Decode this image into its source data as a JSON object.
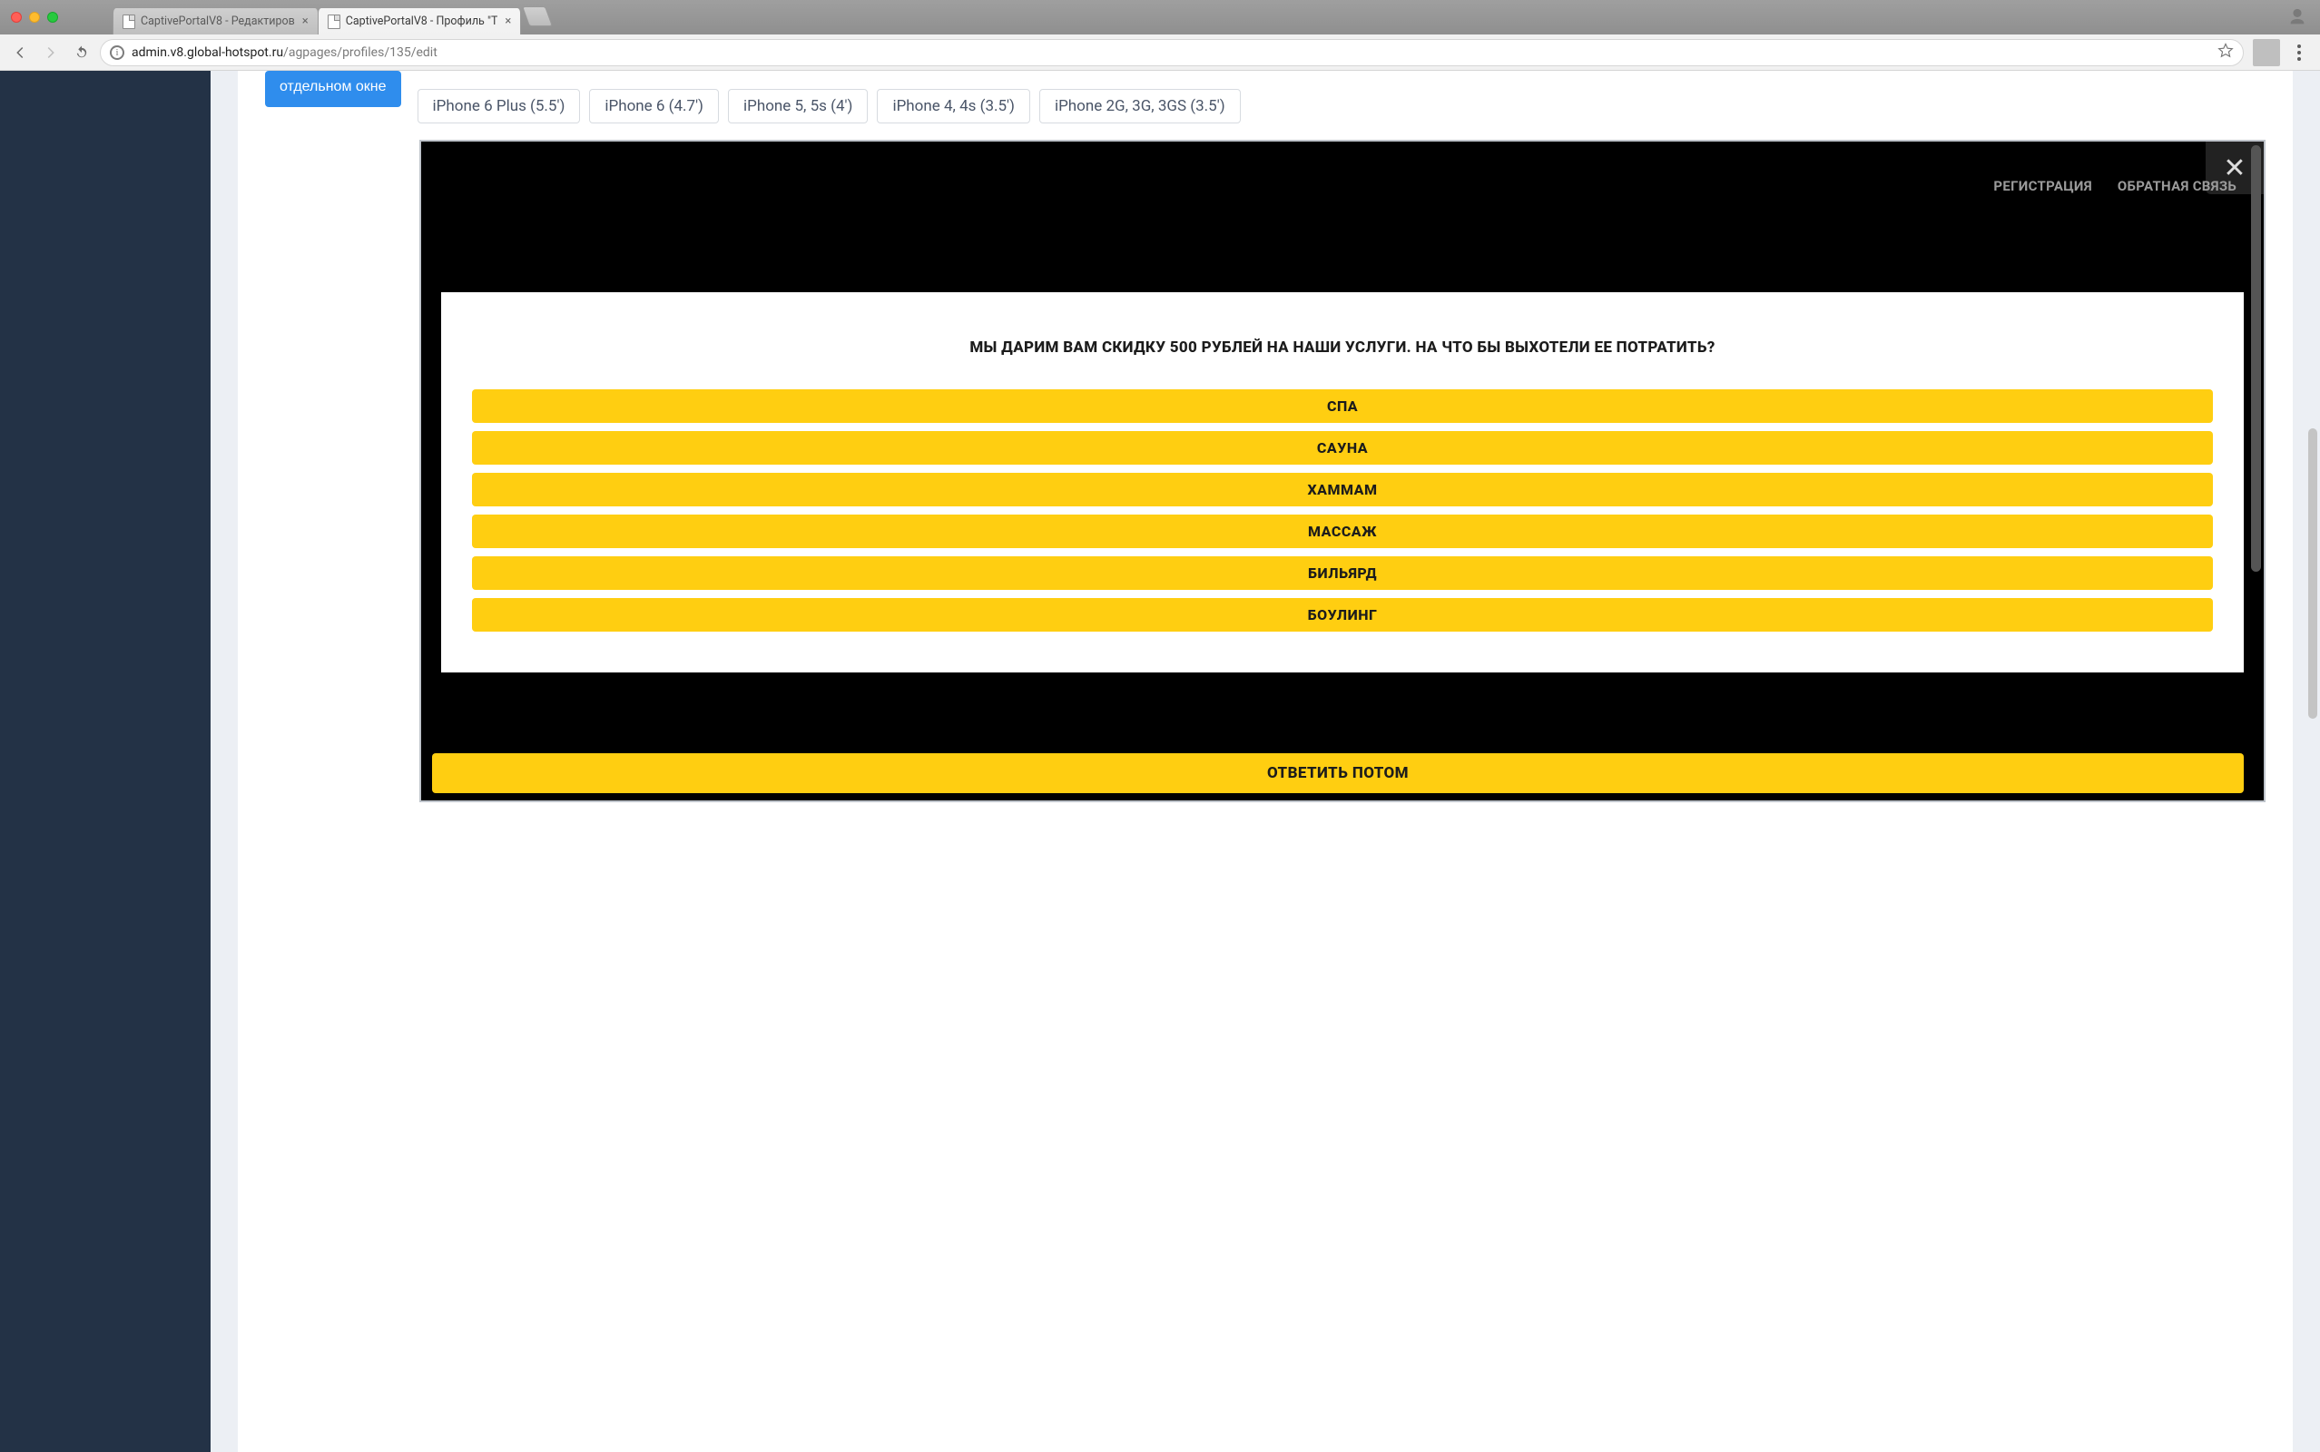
{
  "window": {
    "tabs": [
      {
        "title": "CaptivePortalV8 - Редактиров",
        "active": false
      },
      {
        "title": "CaptivePortalV8 - Профиль \"Т",
        "active": true
      }
    ]
  },
  "toolbar": {
    "url_host": "admin.v8.global-hotspot.ru",
    "url_path": "/agpages/profiles/135/edit"
  },
  "page": {
    "open_window_button_line1": "",
    "open_window_button_line2": "отдельном окне",
    "devices": [
      "iPhone 6 Plus (5.5')",
      "iPhone 6 (4.7')",
      "iPhone 5, 5s (4')",
      "iPhone 4, 4s (3.5')",
      "iPhone 2G, 3G, 3GS (3.5')"
    ]
  },
  "preview": {
    "nav": {
      "register": "РЕГИСТРАЦИЯ",
      "feedback": "ОБРАТНАЯ СВЯЗЬ"
    },
    "poll": {
      "question": "МЫ ДАРИМ ВАМ СКИДКУ 500 РУБЛЕЙ НА НАШИ УСЛУГИ. НА ЧТО БЫ ВЫХОТЕЛИ ЕЕ ПОТРАТИТЬ?",
      "options": [
        "СПА",
        "САУНА",
        "ХАММАМ",
        "МАССАЖ",
        "БИЛЬЯРД",
        "БОУЛИНГ"
      ],
      "answer_later": "ОТВЕТИТЬ ПОТОМ"
    }
  },
  "colors": {
    "accent_yellow": "#ffce11",
    "accent_blue": "#2f8ded",
    "sidebar": "#233246"
  }
}
